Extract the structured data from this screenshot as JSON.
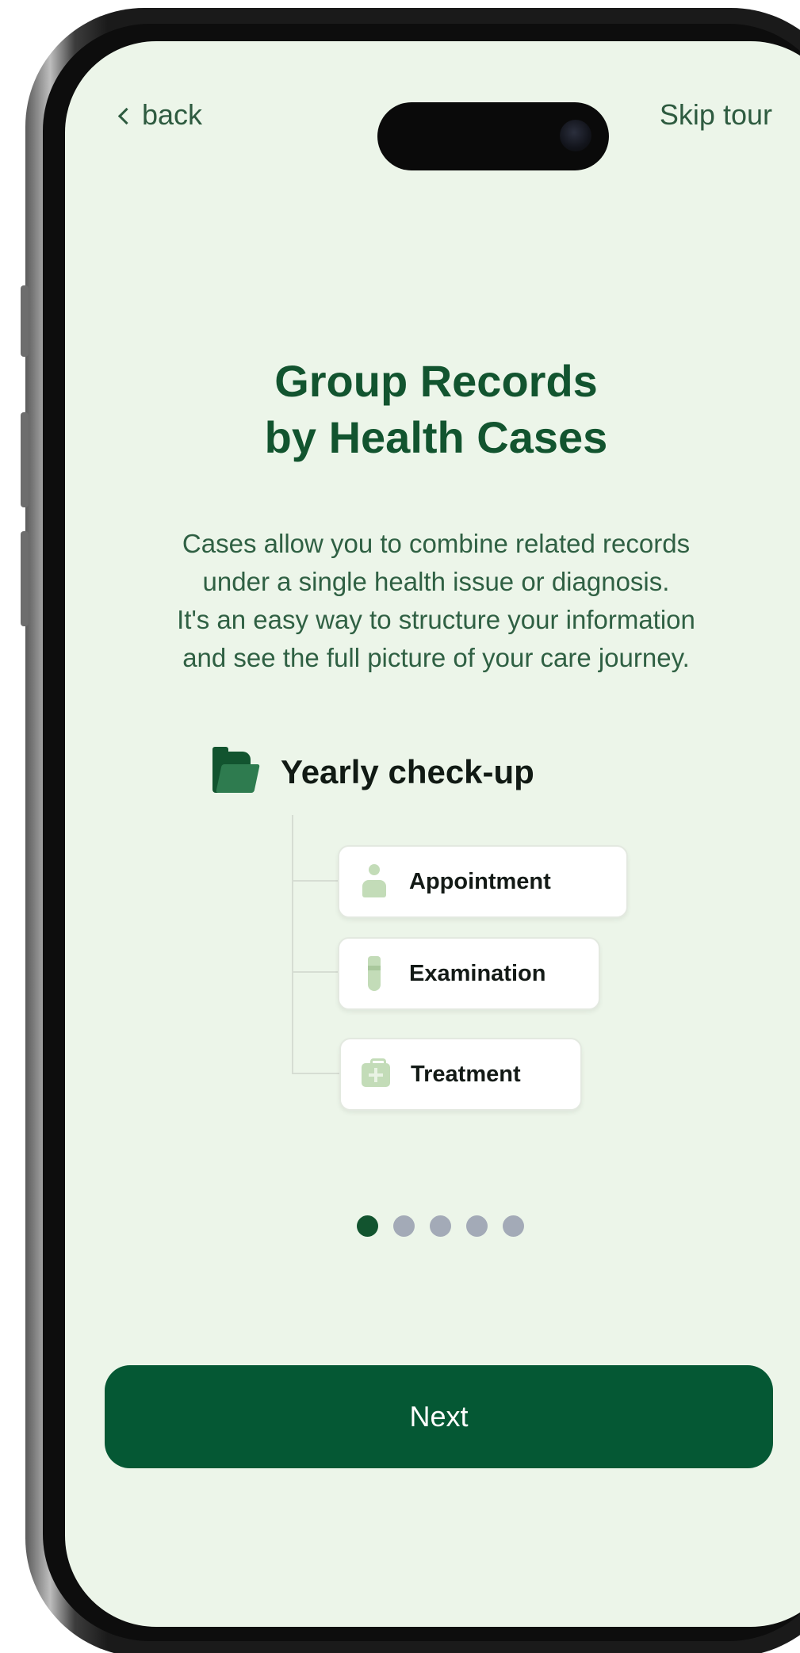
{
  "nav": {
    "back_label": "back",
    "skip_label": "Skip tour"
  },
  "onboarding": {
    "title_lines": [
      "Group Records",
      "by Health Cases"
    ],
    "description_lines": [
      "Cases allow you to combine related records",
      "under a single health issue or diagnosis.",
      "It's an easy way to structure your information",
      "and see the full picture of your care journey."
    ],
    "case": {
      "label": "Yearly check-up",
      "icon": "folder-icon",
      "records": [
        {
          "label": "Appointment",
          "icon": "person-icon"
        },
        {
          "label": "Examination",
          "icon": "test-tube-icon"
        },
        {
          "label": "Treatment",
          "icon": "medical-kit-icon"
        }
      ]
    },
    "pagination": {
      "current": 1,
      "total": 5
    }
  },
  "next_label": "Next",
  "colors": {
    "screen_bg": "#ecf5e9",
    "primary": "#055834",
    "title": "#12542f",
    "text": "#2f6043",
    "dot_inactive": "#a3aab7"
  }
}
